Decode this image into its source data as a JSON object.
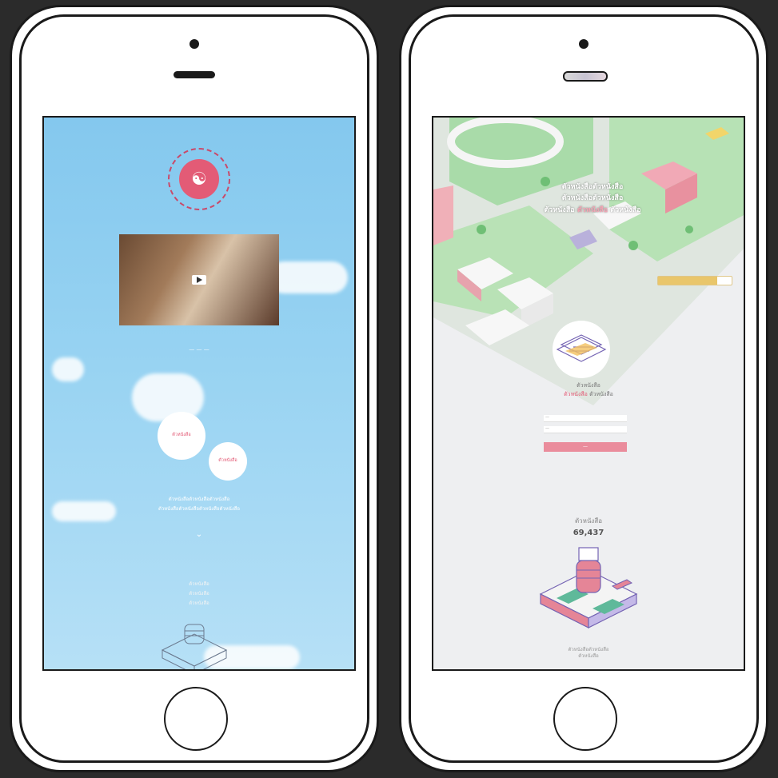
{
  "left_screen": {
    "video_caption": "— — —",
    "bubbles": [
      {
        "text": "ตัวหนังสือ"
      },
      {
        "text": "ตัวหนังสือ"
      }
    ],
    "description_line1": "ตัวหนังสือตัวหนังสือตัวหนังสือ",
    "description_line2": "ตัวหนังสือตัวหนังสือตัวหนังสือตัวหนังสือ",
    "contact_line1": "ตัวหนังสือ",
    "contact_line2": "ตัวหนังสือ",
    "contact_line3": "ตัวหนังสือ"
  },
  "right_screen": {
    "quote_line1": "ตัวหนังสือตัวหนังสือ",
    "quote_line2": "ตัวหนังสือตัวหนังสือ",
    "quote_line3_a": "ตัวหนังสือ",
    "quote_highlight": "ตัวหนังสือ",
    "quote_line3_b": "ตัวหนังสือ",
    "progress_percent": 80,
    "form_heading_line1": "ตัวหนังสือ",
    "form_heading_highlight": "ตัวหนังสือ",
    "form_heading_tail": "ตัวหนังสือ",
    "field1_label": "—",
    "field2_label": "—",
    "submit_label": "—",
    "count_label": "ตัวหนังสือ",
    "count_value": "69,437",
    "footer_line1": "ตัวหนังสือตัวหนังสือ",
    "footer_line2": "ตัวหนังสือ"
  },
  "colors": {
    "accent_pink": "#e35b76",
    "sky_blue": "#84c8ee",
    "progress_gold": "#e9c66b"
  }
}
